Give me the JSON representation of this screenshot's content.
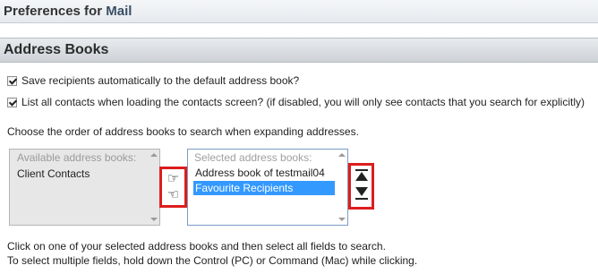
{
  "header": {
    "prefix": "Preferences for",
    "app": "Mail"
  },
  "section": {
    "title": "Address Books"
  },
  "options": [
    {
      "label": "Save recipients automatically to the default address book?",
      "checked": true
    },
    {
      "label": "List all contacts when loading the contacts screen? (if disabled, you will only see contacts that you search for explicitly)",
      "checked": true
    }
  ],
  "order_instruction": "Choose the order of address books to search when expanding addresses.",
  "available": {
    "header": "Available address books:",
    "items": [
      "Client Contacts"
    ]
  },
  "selected": {
    "header": "Selected address books:",
    "items": [
      "Address book of testmail04",
      "Favourite Recipients"
    ],
    "highlighted": "Favourite Recipients"
  },
  "move_buttons": {
    "add_icon": "hand-pointing-right-icon",
    "remove_icon": "hand-pointing-left-icon"
  },
  "order_buttons": {
    "up_icon": "move-up-icon",
    "down_icon": "move-down-icon"
  },
  "help": [
    "Click on one of your selected address books and then select all fields to search.",
    "To select multiple fields, hold down the Control (PC) or Command (Mac) while clicking."
  ],
  "colors": {
    "highlight": "#3399ff",
    "callout_border": "#dd1d1d",
    "app_name": "#3a4f66"
  }
}
